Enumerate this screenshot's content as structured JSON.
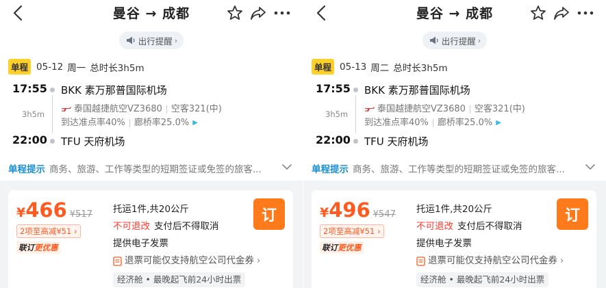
{
  "panels": [
    {
      "header": {
        "title": "曼谷 → 成都"
      },
      "reminder": {
        "label": "出行提醒"
      },
      "trip": {
        "badge": "单程",
        "date": "05-12",
        "weekday": "周一",
        "duration_total": "总时长3h5m"
      },
      "segment": {
        "dep_time": "17:55",
        "dep_airport": "BKK 素万那普国际机场",
        "duration": "3h5m",
        "airline_flight": "泰国越捷航空VZ3680",
        "aircraft": "空客321(中)",
        "on_time": "到达准点率40%",
        "bridge": "廊桥率25.0%",
        "arr_time": "22:00",
        "arr_airport": "TFU 天府机场"
      },
      "tip": {
        "label": "单程提示",
        "text": "商务、旅游、工作等类型的短期签证或免签的旅客..."
      },
      "offer": {
        "currency": "¥",
        "price": "466",
        "original_price": "¥517",
        "discount": "2项至高减¥51",
        "promo_a": "联订",
        "promo_b": "更优惠",
        "baggage": "托运1件,共20公斤",
        "no_change": "不可退改",
        "no_cancel": "支付后不得取消",
        "invoice": "提供电子发票",
        "refund_note": "退票可能仅支持航空公司代金券",
        "cabin": "经济舱 • 最晚起飞前24小时出票",
        "book_label": "订"
      }
    },
    {
      "header": {
        "title": "曼谷 → 成都"
      },
      "reminder": {
        "label": "出行提醒"
      },
      "trip": {
        "badge": "单程",
        "date": "05-13",
        "weekday": "周二",
        "duration_total": "总时长3h5m"
      },
      "segment": {
        "dep_time": "17:55",
        "dep_airport": "BKK 素万那普国际机场",
        "duration": "3h5m",
        "airline_flight": "泰国越捷航空VZ3680",
        "aircraft": "空客321(中)",
        "on_time": "到达准点率40%",
        "bridge": "廊桥率25.0%",
        "arr_time": "22:00",
        "arr_airport": "TFU 天府机场"
      },
      "tip": {
        "label": "单程提示",
        "text": "商务、旅游、工作等类型的短期签证或免签的旅客..."
      },
      "offer": {
        "currency": "¥",
        "price": "496",
        "original_price": "¥547",
        "discount": "2项至高减¥51",
        "promo_a": "联订",
        "promo_b": "更优惠",
        "baggage": "托运1件,共20公斤",
        "no_change": "不可退改",
        "no_cancel": "支付后不得取消",
        "invoice": "提供电子发票",
        "refund_note": "退票可能仅支持航空公司代金券",
        "cabin": "经济舱 • 最晚起飞前24小时出票",
        "book_label": "订"
      }
    }
  ],
  "colors": {
    "accent": "#ff5a1f",
    "book_button": "#ff7a1a",
    "badge": "#ffd02a",
    "tip_label": "#1a8ed6",
    "warning": "#ff3b30"
  },
  "icons": {
    "back": "chevron-left-icon",
    "favorite": "star-outline-icon",
    "share": "share-arrow-icon",
    "more": "more-dots-icon",
    "reminder": "speaker-icon",
    "airline": "airline-logo-icon",
    "refund": "document-icon"
  }
}
